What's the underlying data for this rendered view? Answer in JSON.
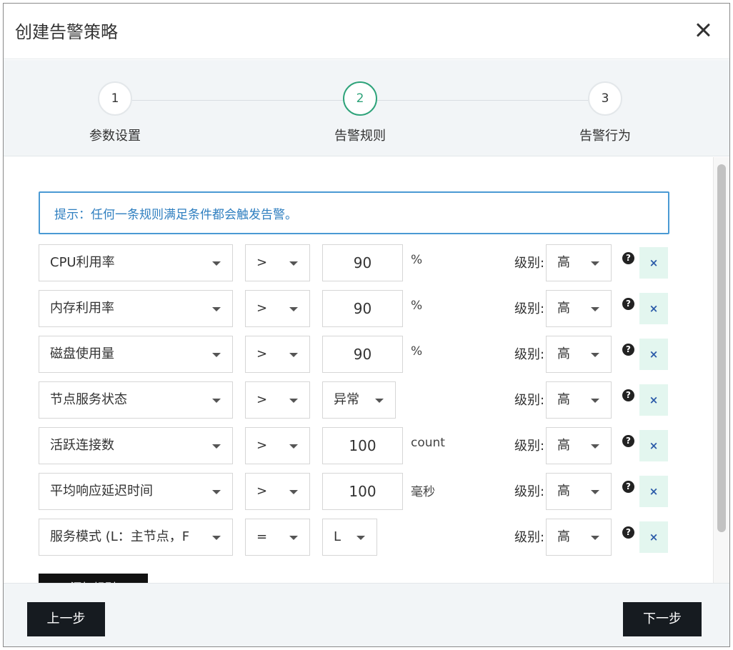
{
  "dialog": {
    "title": "创建告警策略"
  },
  "steps": [
    {
      "number": "1",
      "label": "参数设置"
    },
    {
      "number": "2",
      "label": "告警规则"
    },
    {
      "number": "3",
      "label": "告警行为"
    }
  ],
  "active_step": 2,
  "tip": "提示：任何一条规则满足条件都会触发告警。",
  "level_label": "级别:",
  "rules": [
    {
      "metric": "CPU利用率",
      "operator": ">",
      "value": "90",
      "unit": "%",
      "level": "高"
    },
    {
      "metric": "内存利用率",
      "operator": ">",
      "value": "90",
      "unit": "%",
      "level": "高"
    },
    {
      "metric": "磁盘使用量",
      "operator": ">",
      "value": "90",
      "unit": "%",
      "level": "高"
    },
    {
      "metric": "节点服务状态",
      "operator": ">",
      "value": "异常",
      "unit": "",
      "level": "高"
    },
    {
      "metric": "活跃连接数",
      "operator": ">",
      "value": "100",
      "unit": "count",
      "level": "高"
    },
    {
      "metric": "平均响应延迟时间",
      "operator": ">",
      "value": "100",
      "unit": "毫秒",
      "level": "高"
    },
    {
      "metric": "服务模式 (L：主节点，F",
      "operator": "=",
      "value": "L",
      "unit": "",
      "level": "高"
    }
  ],
  "add_rule_label": "添加规则",
  "footer": {
    "prev_label": "上一步",
    "next_label": "下一步"
  },
  "colors": {
    "accent": "#2ea37a",
    "tip_border": "#4a9ad4",
    "tip_text": "#2f7fc0",
    "delete_bg": "#e3f6ef",
    "button_dark": "#161b20"
  },
  "icons": {
    "close": "close-icon",
    "caret": "chevron-down-icon",
    "help": "question-icon",
    "delete": "x-icon"
  }
}
